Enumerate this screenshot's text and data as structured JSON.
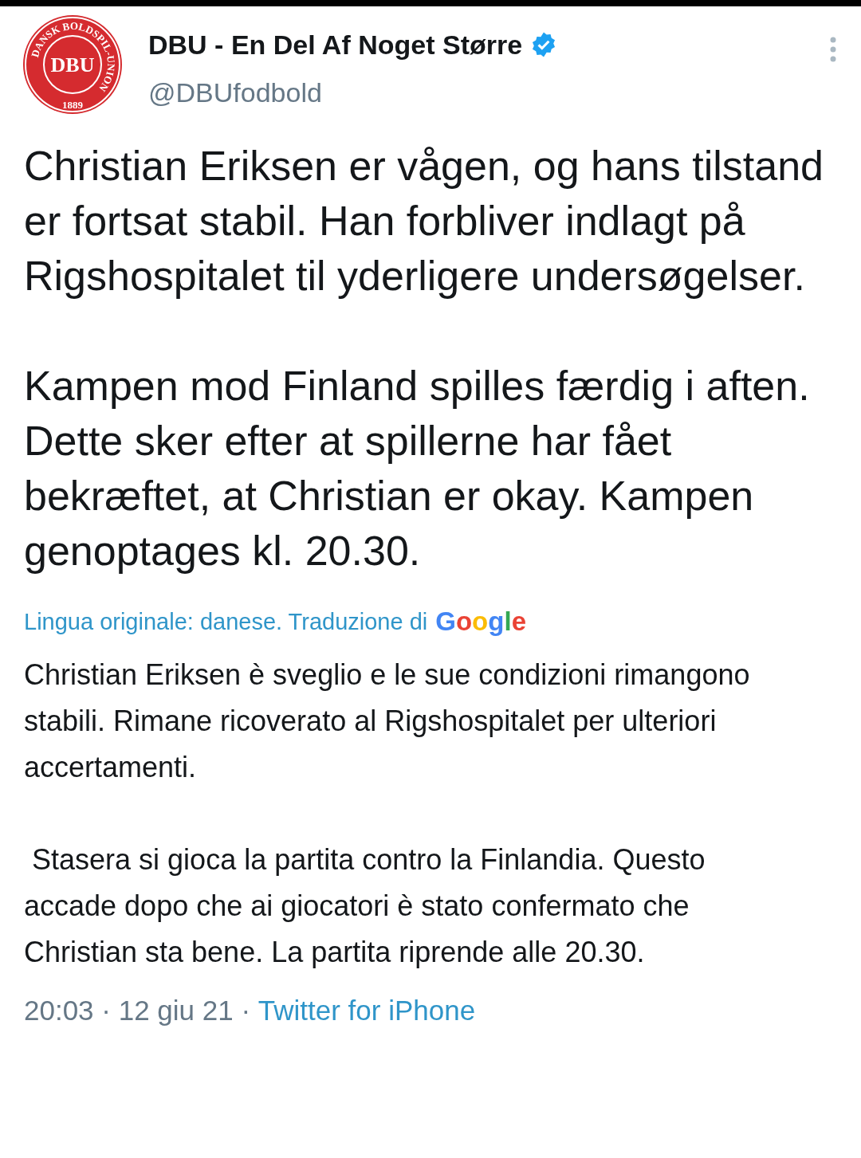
{
  "author": {
    "name": "DBU - En Del Af Noget Større",
    "verified": true,
    "handle": "@DBUfodbold",
    "logo": {
      "initials": "DBU",
      "ring_text": "DANSK BOLDSPIL-UNION",
      "year": "1889"
    }
  },
  "original_text": [
    "Christian Eriksen er vågen, og hans tilstand er fortsat stabil. Han forbliver indlagt på Rigshospitalet til yderligere undersøgelser.",
    "Kampen mod Finland spilles færdig i aften. Dette sker efter at spillerne har fået bekræftet, at Christian er okay. Kampen genoptages kl. 20.30."
  ],
  "translation": {
    "note": "Lingua originale: danese. Traduzione di",
    "provider": "Google",
    "text": [
      "Christian Eriksen è sveglio e le sue condizioni rimangono stabili. Rimane ricoverato al Rigshospitalet per ulteriori accertamenti.",
      " Stasera si gioca la partita contro la Finlandia. Questo accade dopo che ai giocatori è stato confermato che Christian sta bene. La partita riprende alle 20.30."
    ]
  },
  "meta": {
    "timestamp": "20:03 · 12 giu 21 ·",
    "source": "Twitter for iPhone"
  }
}
